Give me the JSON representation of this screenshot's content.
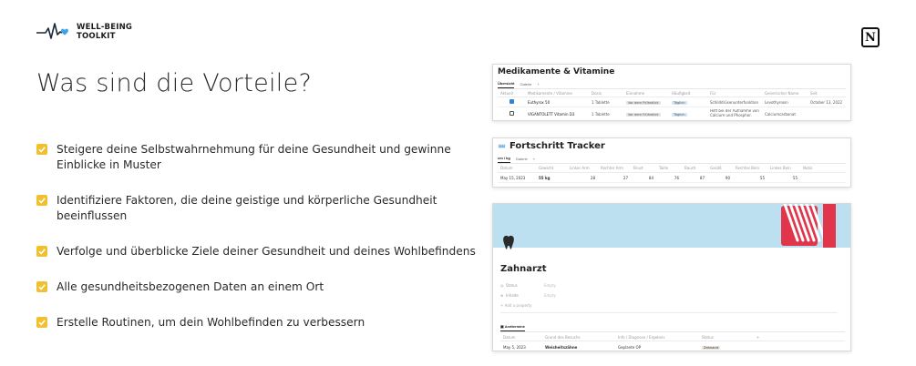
{
  "logo": {
    "line1": "WELL-BEING",
    "line2": "TOOLKIT",
    "heart_color": "#3ba3e6"
  },
  "notion_icon": "N",
  "page_title": "Was sind die Vorteile?",
  "accent_color": "#f2c02e",
  "benefits": [
    "Steigere deine Selbstwahrnehmung für deine Gesundheit und gewinne Einblicke in Muster",
    "Identifiziere Faktoren, die deine geistige und körperliche Gesundheit beeinflussen",
    "Verfolge und überblicke Ziele deiner Gesundheit und deines Wohlbefindens",
    "Alle gesundheitsbezogenen Daten an einem Ort",
    "Erstelle Routinen, um dein Wohlbefinden zu verbessern"
  ],
  "med_card": {
    "title": "Medikamente & Vitamine",
    "tabs": [
      "Übersicht",
      "Galerie",
      "+"
    ],
    "headers": [
      "Aktuell",
      "Medikamente / Vitamine",
      "Dosis",
      "Einnahme",
      "Häufigkeit",
      "Für",
      "Generischer Name",
      "Seit"
    ],
    "rows": [
      {
        "checked": true,
        "name": "Euthyrox 50",
        "dose": "1 Tablette",
        "intake": "Vor dem Frühstück",
        "freq": "Täglich",
        "for": "Schilddrüsenunterfunktion",
        "generic": "Levothyroxin",
        "since": "October 13, 2022"
      },
      {
        "checked": false,
        "name": "VIGANTOLETT Vitamin D3",
        "dose": "1 Tablette",
        "intake": "Vor dem Frühstück",
        "freq": "Täglich",
        "for": "Hilft bei der Aufnahme von Calcium und Phosphor.",
        "generic": "Calciumcarbonat",
        "since": ""
      }
    ]
  },
  "tracker_card": {
    "title": "Fortschritt Tracker",
    "tabs": [
      "cm / kg",
      "Galerie",
      "+"
    ],
    "headers": [
      "Datum",
      "Gewicht",
      "Linker Arm",
      "Rechter Arm",
      "Brust",
      "Taille",
      "Bauch",
      "Gesäß",
      "Rechtes Bein",
      "Linkes Bein",
      "Notiz"
    ],
    "row": [
      "May 15, 2023",
      "55 kg",
      "28",
      "27",
      "84",
      "76",
      "87",
      "90",
      "55",
      "55",
      ""
    ]
  },
  "dentist_card": {
    "title": "Zahnarzt",
    "properties": [
      {
        "label": "Status",
        "value": "Empty"
      },
      {
        "label": "Inhalte",
        "value": "Empty"
      }
    ],
    "add_property": "+ Add a property",
    "section_tab": "Arzttermine",
    "headers": [
      "Datum",
      "Grund des Besuchs",
      "Info / Diagnose / Ergebnis",
      "Status",
      "+"
    ],
    "row": [
      "May 5, 2023",
      "Weisheitszähne",
      "Geplante OP",
      "Zahnarzt"
    ],
    "cover_color": "#bde0f0",
    "brush_color": "#e0354b"
  }
}
